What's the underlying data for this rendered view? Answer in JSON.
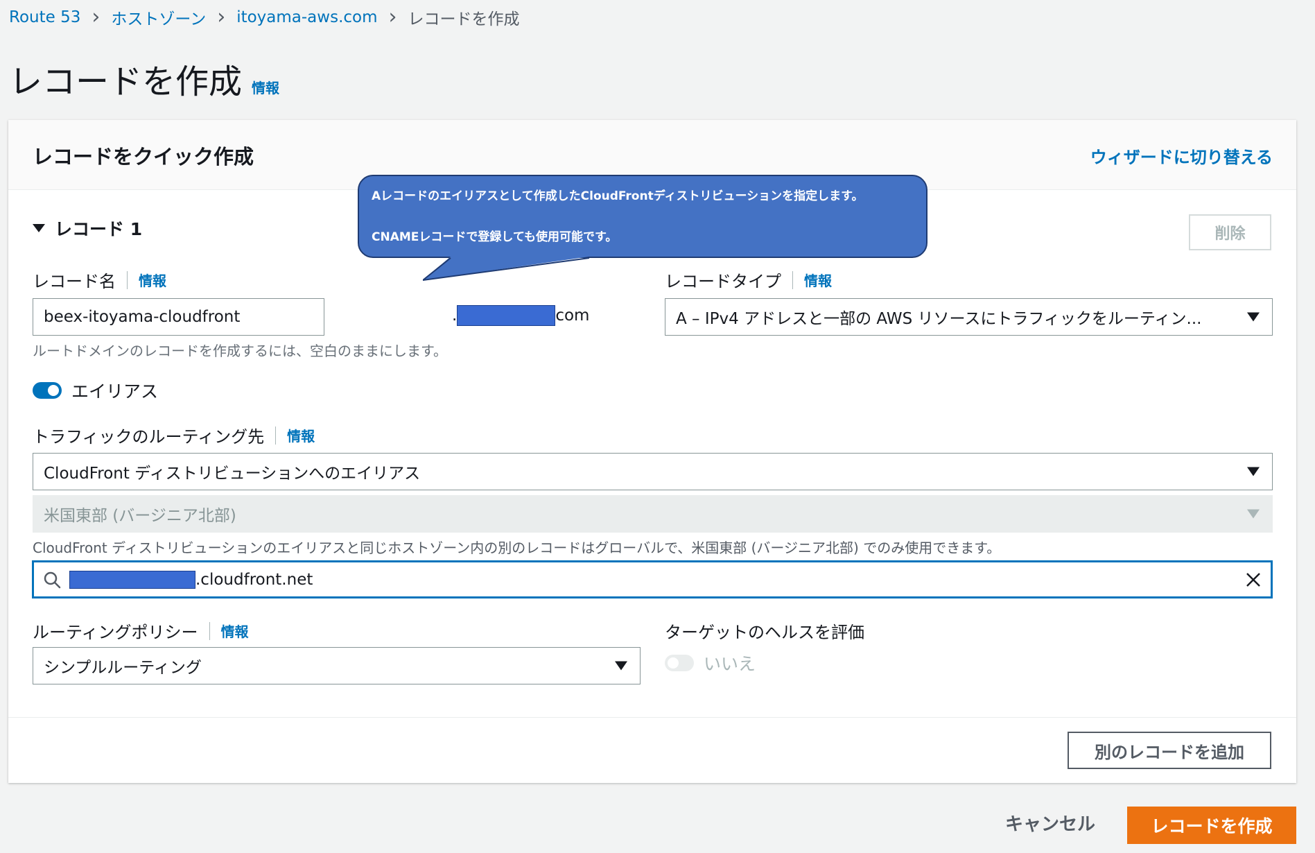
{
  "breadcrumb": {
    "items": [
      "Route 53",
      "ホストゾーン",
      "itoyama-aws.com"
    ],
    "current": "レコードを作成"
  },
  "page": {
    "title": "レコードを作成",
    "info": "情報"
  },
  "panel": {
    "title": "レコードをクイック作成",
    "switch_wizard": "ウィザードに切り替える"
  },
  "record": {
    "section_label": "レコード 1",
    "delete_button": "削除",
    "name_label": "レコード名",
    "name_info": "情報",
    "name_value": "beex-itoyama-cloudfront",
    "name_suffix": "com",
    "name_hint": "ルートドメインのレコードを作成するには、空白のままにします。",
    "type_label": "レコードタイプ",
    "type_info": "情報",
    "type_value": "A – IPv4 アドレスと一部の AWS リソースにトラフィックをルーティン...",
    "alias_label": "エイリアス",
    "alias_enabled": true,
    "route_label": "トラフィックのルーティング先",
    "route_info": "情報",
    "route_value": "CloudFront ディストリビューションへのエイリアス",
    "region_value": "米国東部 (バージニア北部)",
    "region_hint": "CloudFront ディストリビューションのエイリアスと同じホストゾーン内の別のレコードはグローバルで、米国東部 (バージニア北部) でのみ使用できます。",
    "target_suffix": ".cloudfront.net",
    "policy_label": "ルーティングポリシー",
    "policy_info": "情報",
    "policy_value": "シンプルルーティング",
    "health_label": "ターゲットのヘルスを評価",
    "health_value": "いいえ",
    "health_enabled": false
  },
  "add_record_button": "別のレコードを追加",
  "cancel_button": "キャンセル",
  "create_button": "レコードを作成",
  "callout": {
    "line1": "Aレコードのエイリアスとして作成したCloudFrontディストリビューションを指定します。",
    "line2": "CNAMEレコードで登録しても使用可能です。"
  },
  "colors": {
    "link": "#0073bb",
    "primary": "#ec7211",
    "callout": "#4472c4",
    "redaction": "#3a6bd3"
  }
}
